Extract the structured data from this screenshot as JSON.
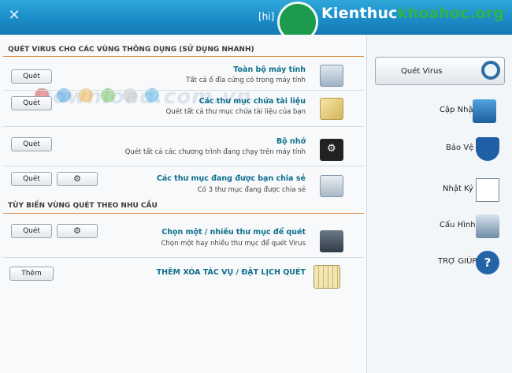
{
  "titlebar": {
    "close_glyph": "✕",
    "title": "[hi]",
    "watermark_a": "Kienthuc",
    "watermark_b": "khoahoc",
    "watermark_c": ".org",
    "logo_glyph": "💡"
  },
  "main": {
    "watermark": "Download.com.vn",
    "section_quick": "QUÉT VIRUS CHO CÁC VÙNG THÔNG DỤNG (SỬ DỤNG NHANH)",
    "section_custom": "TÙY BIẾN VÙNG QUÉT THEO NHU CẦU",
    "rows": [
      {
        "title": "Toàn bộ máy tính",
        "desc": "Tất cả ổ đĩa cứng có trong máy tính",
        "button": "Quét"
      },
      {
        "title": "Các thư mục chứa tài liệu",
        "desc": "Quét tất cả thư mục chứa tài liệu của bạn",
        "button": "Quét"
      },
      {
        "title": "Bộ nhớ",
        "desc": "Quét tất cả các chương trình đang chạy trên máy tính",
        "button": "Quét"
      },
      {
        "title": "Các thư mục đang được bạn chia sẻ",
        "desc": "Có 3 thư mục đang được chia sẻ",
        "button": "Quét"
      },
      {
        "title": "Chọn một / nhiều thư mục để quét",
        "desc": "Chọn một hay nhiều thư mục để quét Virus",
        "button": "Quét"
      },
      {
        "title": "THÊM XÓA TÁC VỤ / ĐẶT LỊCH QUÉT",
        "desc": "",
        "button": "Thêm"
      }
    ],
    "gear_glyph": "⚙",
    "dot_colors": [
      "#e35b5b",
      "#4aa3e0",
      "#f2b64a",
      "#7bc46a",
      "#c9c9c9",
      "#59b7e8"
    ]
  },
  "sidebar": {
    "items": [
      {
        "label": "Quét Virus",
        "icon": "magnifier-icon"
      },
      {
        "label": "Cập Nhật",
        "icon": "monitor-update-icon"
      },
      {
        "label": "Bảo Vệ",
        "icon": "shield-icon"
      },
      {
        "label": "Nhật Ký",
        "icon": "notebook-icon"
      },
      {
        "label": "Cấu Hình",
        "icon": "config-icon"
      },
      {
        "label": "TRỢ GIÚP",
        "icon": "help-icon"
      }
    ],
    "help_glyph": "?"
  }
}
